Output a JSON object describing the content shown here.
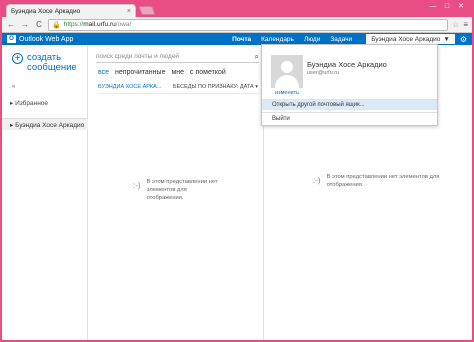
{
  "browser": {
    "tab_title": "Буэндиа Хосе Аркадио",
    "tab_close": "×",
    "lock": "🔒",
    "url_scheme": "https://",
    "url_host": "mail.urfu.ru",
    "url_path": "/owa/",
    "back": "←",
    "forward": "→",
    "reload": "C",
    "star": "☆",
    "menu": "≡",
    "win_min": "—",
    "win_max": "□",
    "win_close": "✕"
  },
  "owa": {
    "app_name": "Outlook Web App",
    "logo_letter": "O",
    "nav": [
      "Почта",
      "Календарь",
      "Люди",
      "Задачи"
    ],
    "user_name": "Буэндиа Хосе Аркадио",
    "user_caret": "▼",
    "gear": "⚙",
    "new_mail": "создать сообщение",
    "new_mail_plus": "+",
    "collapse": "«",
    "favorites": "▸ Избранное",
    "account": "▸ Буэндиа Хосе Аркадио",
    "search_placeholder": "поиск среди почты и людей",
    "search_icon": "⌕",
    "filters": [
      "все",
      "непрочитанные",
      "мне",
      "с пометкой"
    ],
    "sort_owner": "БУЭНДИА ХОСЕ АРКА...",
    "sort_by": "БЕСЕДЫ ПО ПРИЗНАКУ: ДАТА ▾",
    "empty_face": ":-)",
    "empty_list": "В этом представлении нет элементов для отображения.",
    "empty_read": "В этом представлении нет элементов для отображения."
  },
  "dropdown": {
    "name": "Буэндиа Хосе Аркадио",
    "email": "user@urfu.ru",
    "change": "изменить",
    "open_other": "Открыть другой почтовый ящик...",
    "sign_out": "Выйти"
  },
  "colors": {
    "accent": "#0072c6",
    "frame": "#e84d86",
    "highlight": "#dceaf7"
  }
}
